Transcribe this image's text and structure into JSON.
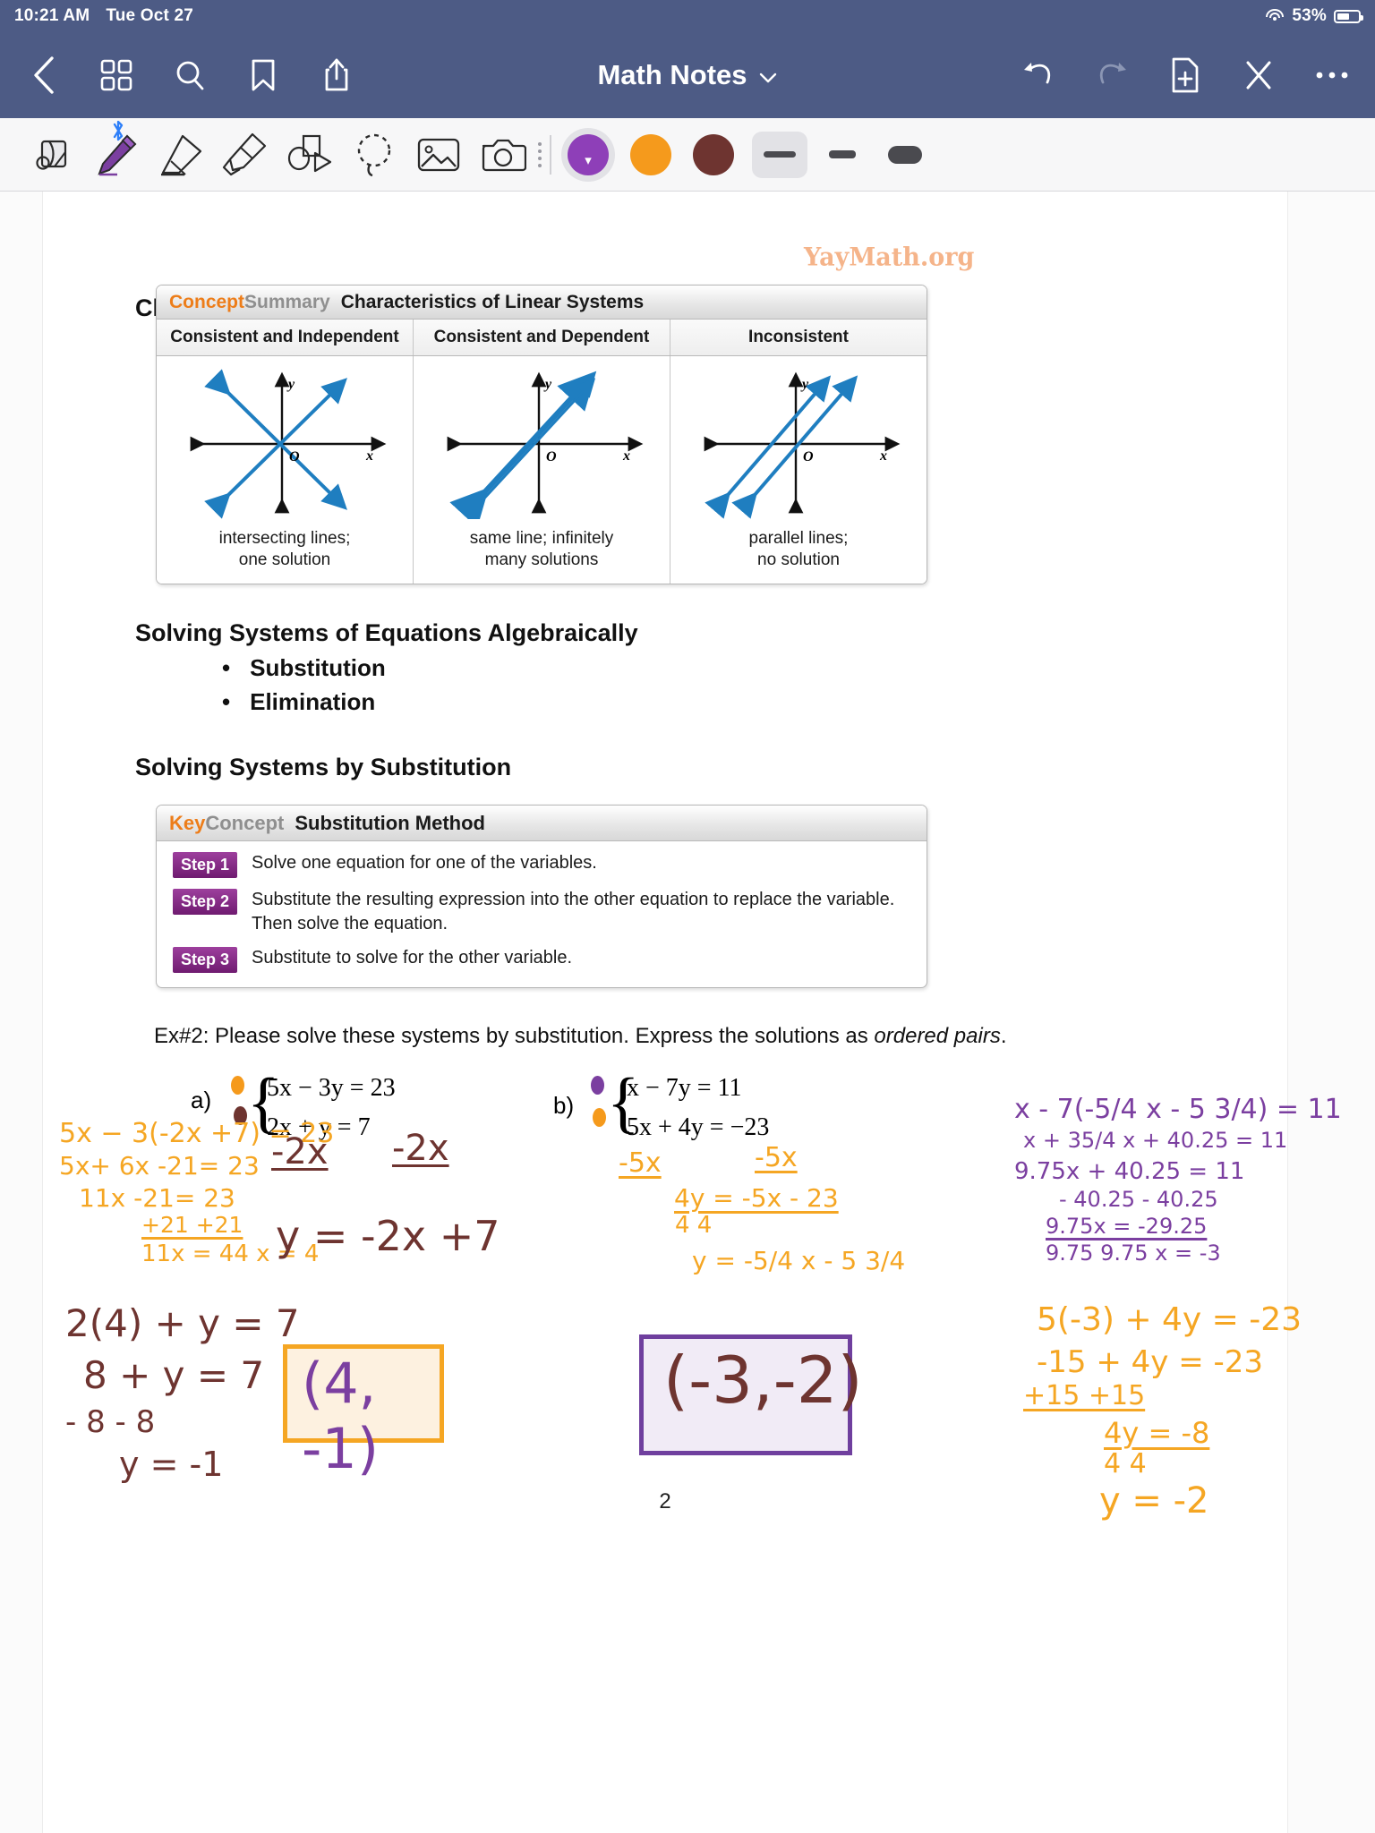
{
  "status_bar": {
    "time": "10:21 AM",
    "date": "Tue Oct 27",
    "battery_percent": "53%",
    "wifi_icon": "wifi-icon",
    "battery_icon": "battery-icon"
  },
  "nav_bar": {
    "title": "Math Notes",
    "title_chevron": "⌄",
    "left_icons": [
      "back-chevron-icon",
      "grid-view-icon",
      "search-icon",
      "bookmark-icon",
      "share-icon"
    ],
    "right_icons": [
      "undo-icon",
      "redo-icon",
      "add-page-icon",
      "close-icon",
      "more-options-icon"
    ]
  },
  "toolbar": {
    "tools": [
      {
        "name": "page-flip-tool",
        "label": "Page"
      },
      {
        "name": "pen-tool",
        "label": "Pen",
        "selected": true,
        "bluetooth_badge": "ᛗ"
      },
      {
        "name": "eraser-tool",
        "label": "Eraser"
      },
      {
        "name": "highlighter-tool",
        "label": "Highlighter"
      },
      {
        "name": "shape-tool",
        "label": "Shapes"
      },
      {
        "name": "lasso-select-tool",
        "label": "Lasso"
      },
      {
        "name": "image-tool",
        "label": "Image"
      },
      {
        "name": "camera-tool",
        "label": "Camera"
      }
    ],
    "colors": [
      {
        "name": "color-swatch-purple",
        "hex": "#8e3fb8",
        "selected": true
      },
      {
        "name": "color-swatch-orange",
        "hex": "#f59a1c",
        "selected": false
      },
      {
        "name": "color-swatch-maroon",
        "hex": "#6e3430",
        "selected": false
      }
    ],
    "stroke_widths": [
      {
        "name": "stroke-width-large",
        "selected": true
      },
      {
        "name": "stroke-width-medium",
        "selected": false
      },
      {
        "name": "stroke-width-small",
        "selected": false
      }
    ]
  },
  "document": {
    "watermark": "YayMath.org",
    "page_number": "2",
    "heading_classification": "Classification of Systems of Equations",
    "heading_algebraic": "Solving Systems of Equations Algebraically",
    "bullets": [
      "Substitution",
      "Elimination"
    ],
    "heading_substitution": "Solving Systems by Substitution",
    "concept_summary": {
      "brand_first": "Concept",
      "brand_second": "Summary",
      "title": "Characteristics of Linear Systems",
      "columns": [
        {
          "header": "Consistent and Independent",
          "caption_line1": "intersecting lines;",
          "caption_line2": "one solution",
          "graph": "two-intersecting-lines-graph"
        },
        {
          "header": "Consistent and Dependent",
          "caption_line1": "same line; infinitely",
          "caption_line2": "many solutions",
          "graph": "coincident-line-graph"
        },
        {
          "header": "Inconsistent",
          "caption_line1": "parallel lines;",
          "caption_line2": "no solution",
          "graph": "two-parallel-lines-graph"
        }
      ],
      "axis_labels": {
        "x": "x",
        "y": "y",
        "origin": "O"
      }
    },
    "key_concept": {
      "brand_first": "Key",
      "brand_second": "Concept",
      "title": "Substitution Method",
      "steps": [
        {
          "tag": "Step 1",
          "text": "Solve one equation for one of the variables."
        },
        {
          "tag": "Step 2",
          "text": "Substitute the resulting expression into the other equation to replace the variable. Then solve the equation."
        },
        {
          "tag": "Step 3",
          "text": "Substitute to solve for the other variable."
        }
      ]
    },
    "exercise": {
      "prompt_plain": "Ex#2:  Please solve these systems by substitution. Express the solutions as ",
      "prompt_italic": "ordered pairs",
      "prompt_end": ".",
      "problem_a": {
        "label": "a)",
        "equation1": "5x − 3y = 23",
        "equation2": "2x + y = 7",
        "work": [
          "5x − 3(-2x +7) = 23",
          "5x+ 6x -21= 23",
          "11x -21= 23",
          "+21   +21",
          "11x  = 44    x = 4",
          "2(4) + y = 7",
          "8 + y = 7",
          "- 8        - 8",
          "y =  -1",
          "-2x",
          "-2x",
          "y = -2x +7"
        ],
        "answer": "(4, -1)"
      },
      "problem_b": {
        "label": "b)",
        "equation1": "x − 7y = 11",
        "equation2": "5x + 4y = −23",
        "work": [
          "-5x",
          "-5x",
          "4y = -5x - 23",
          "4       4",
          "y = -5/4 x - 5 3/4",
          "x - 7(-5/4 x - 5 3/4) = 11",
          "x + 35/4 x + 40.25 = 11",
          "9.75x + 40.25 = 11",
          "- 40.25  - 40.25",
          "9.75x  =  -29.25",
          "9.75        9.75      x = -3",
          "5(-3) + 4y = -23",
          "-15 + 4y = -23",
          "+15            +15",
          "4y      = -8",
          "4          4",
          "y = -2"
        ],
        "answer": "(-3,-2)"
      }
    }
  },
  "colors": {
    "nav_bg": "#4d5b85",
    "toolbar_bg": "#f7f7f8",
    "brand_orange": "#ed7d19",
    "step_purple": "#6f1b70",
    "ink_orange": "#f5a623",
    "ink_maroon": "#6e3430",
    "ink_purple": "#7b3fa0",
    "watermark": "#f5b48a",
    "graph_blue": "#1f7ec0"
  }
}
